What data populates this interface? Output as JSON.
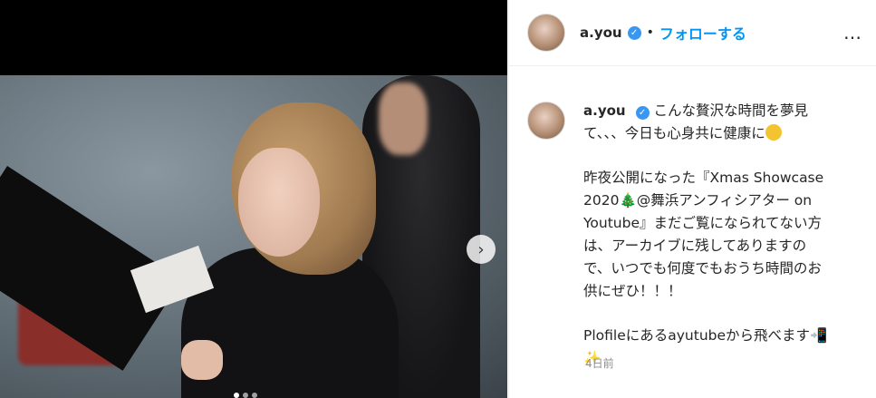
{
  "post": {
    "username": "a.you",
    "separator": "•",
    "follow_label": "フォローする",
    "more_icon": "…",
    "arrow_icon": "›",
    "caption_lines": [
      "こんな贅沢な時間を夢見",
      "て、、、今日も心身共に健康に",
      "",
      "昨夜公開になった『Xmas Showcase",
      "2020🎄@舞浜アンフィシアター on",
      "Youtube』まだご覧になられてない方",
      "は、アーカイブに残してありますの",
      "で、いつでも何度でもおうち時間のお",
      "供にぜひ！！！",
      "",
      "Plofileにあるayutubeから飛べます📲",
      "✨"
    ],
    "timestamp": "4日前"
  },
  "colors": {
    "follow": "#0095f6",
    "verified": "#3897f0"
  }
}
